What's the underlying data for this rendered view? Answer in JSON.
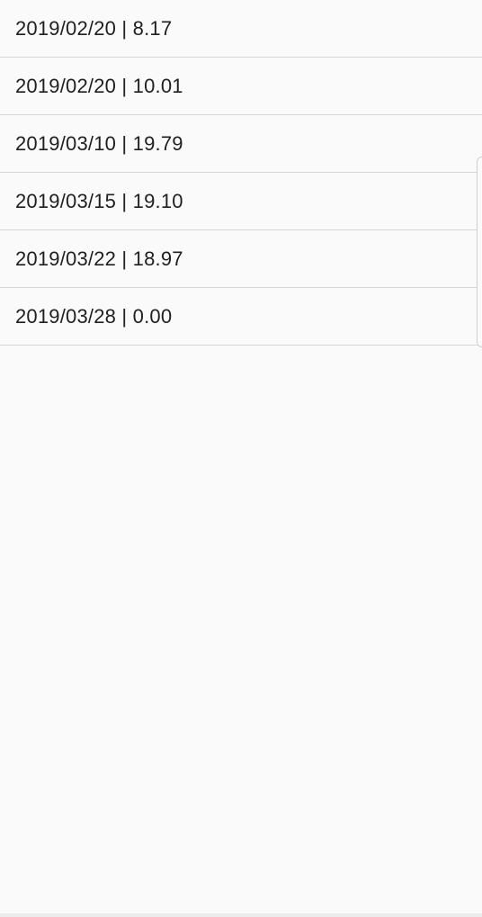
{
  "entries": [
    {
      "label": "2019/02/20 | 8.17"
    },
    {
      "label": "2019/02/20 | 10.01"
    },
    {
      "label": "2019/03/10 | 19.79"
    },
    {
      "label": "2019/03/15 | 19.10"
    },
    {
      "label": "2019/03/22 | 18.97"
    },
    {
      "label": "2019/03/28 | 0.00"
    }
  ],
  "colors": {
    "background": "#fafafa",
    "text": "#1f1f1f",
    "divider": "#d6d6d6"
  }
}
